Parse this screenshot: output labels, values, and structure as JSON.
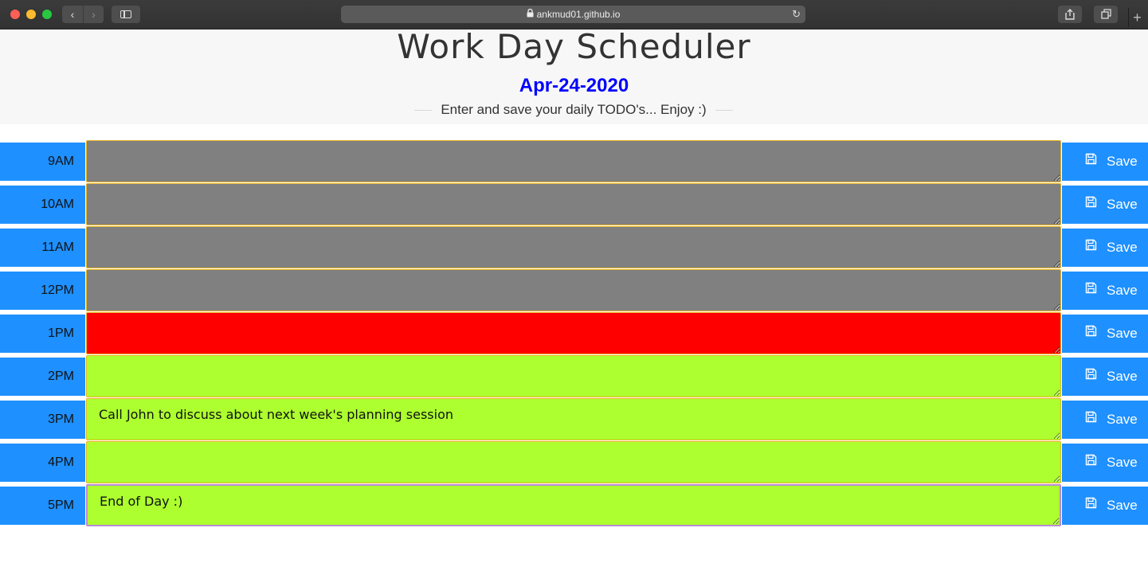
{
  "browser": {
    "url": "ankmud01.github.io",
    "nav_back": "‹",
    "nav_forward": "›",
    "share_glyph": "⇪",
    "tabs_glyph": "❐",
    "newtab_glyph": "+",
    "reload_glyph": "↻",
    "lock_glyph": "🔒"
  },
  "header": {
    "title": "Work Day Scheduler",
    "date": "Apr-24-2020",
    "lead": "Enter and save your daily TODO's... Enjoy :)"
  },
  "colors": {
    "past": "#808080",
    "present": "#ff0000",
    "future": "#adff2f",
    "accent": "#1e90ff",
    "date": "#0000ff"
  },
  "rows": [
    {
      "hour": "9AM",
      "task": "",
      "state": "past",
      "save_label": "Save"
    },
    {
      "hour": "10AM",
      "task": "",
      "state": "past",
      "save_label": "Save"
    },
    {
      "hour": "11AM",
      "task": "",
      "state": "past",
      "save_label": "Save"
    },
    {
      "hour": "12PM",
      "task": "",
      "state": "past",
      "save_label": "Save"
    },
    {
      "hour": "1PM",
      "task": "",
      "state": "present",
      "save_label": "Save"
    },
    {
      "hour": "2PM",
      "task": "",
      "state": "future",
      "save_label": "Save"
    },
    {
      "hour": "3PM",
      "task": "Call John to discuss about next week's planning session",
      "state": "future",
      "save_label": "Save"
    },
    {
      "hour": "4PM",
      "task": "",
      "state": "future",
      "save_label": "Save"
    },
    {
      "hour": "5PM",
      "task": "End of Day :)",
      "state": "future",
      "save_label": "Save"
    }
  ]
}
